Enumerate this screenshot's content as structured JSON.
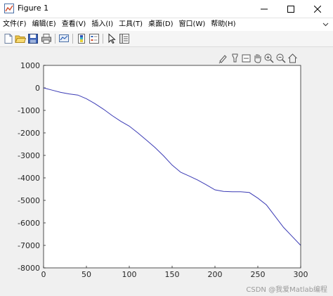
{
  "window": {
    "title": "Figure 1",
    "app_icon": "matlab-figure-icon"
  },
  "menubar": {
    "items": [
      "文件(F)",
      "编辑(E)",
      "查看(V)",
      "插入(I)",
      "工具(T)",
      "桌面(D)",
      "窗口(W)",
      "帮助(H)"
    ]
  },
  "toolbar": {
    "buttons": [
      "new-figure-icon",
      "open-file-icon",
      "save-icon",
      "print-icon",
      "link-plot-icon",
      "colorbar-icon",
      "legend-icon",
      "pointer-icon",
      "property-inspector-icon"
    ]
  },
  "axes_toolbar": {
    "buttons": [
      "brush-icon",
      "data-tips-icon",
      "rotate-icon",
      "pan-icon",
      "zoom-in-icon",
      "zoom-out-icon",
      "home-icon"
    ]
  },
  "watermark": "CSDN @我爱Matlab编程",
  "colors": {
    "line": "#3b3bb5",
    "axes_background": "#ffffff",
    "figure_background": "#f0f0f0"
  },
  "chart_data": {
    "type": "line",
    "title": "",
    "xlabel": "",
    "ylabel": "",
    "xlim": [
      0,
      300
    ],
    "ylim": [
      -8000,
      1000
    ],
    "xticks": [
      0,
      50,
      100,
      150,
      200,
      250,
      300
    ],
    "yticks": [
      1000,
      0,
      -1000,
      -2000,
      -3000,
      -4000,
      -5000,
      -6000,
      -7000,
      -8000
    ],
    "grid": false,
    "series": [
      {
        "x": [
          0,
          10,
          20,
          30,
          40,
          50,
          60,
          70,
          80,
          90,
          100,
          110,
          120,
          130,
          140,
          150,
          160,
          170,
          180,
          190,
          200,
          210,
          220,
          230,
          240,
          250,
          260,
          270,
          280,
          290,
          300
        ],
        "y": [
          0,
          -100,
          -200,
          -270,
          -320,
          -480,
          -700,
          -950,
          -1230,
          -1480,
          -1700,
          -2000,
          -2320,
          -2650,
          -3020,
          -3430,
          -3750,
          -3920,
          -4100,
          -4310,
          -4530,
          -4600,
          -4620,
          -4620,
          -4650,
          -4900,
          -5200,
          -5700,
          -6200,
          -6600,
          -7000
        ]
      }
    ]
  }
}
